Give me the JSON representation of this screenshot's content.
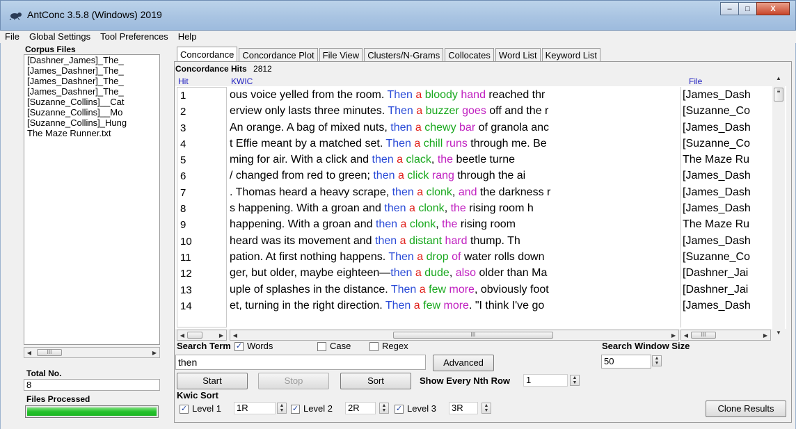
{
  "window": {
    "title": "AntConc 3.5.8 (Windows) 2019",
    "minimize": "–",
    "maximize": "□",
    "close": "X"
  },
  "menu": [
    "File",
    "Global Settings",
    "Tool Preferences",
    "Help"
  ],
  "left_panel": {
    "corpus_label": "Corpus Files",
    "files": [
      "[Dashner_James]_The_",
      "[James_Dashner]_The_",
      "[James_Dashner]_The_",
      "[James_Dashner]_The_",
      "[Suzanne_Collins]__Cat",
      "[Suzanne_Collins]__Mo",
      "[Suzanne_Collins]_Hung",
      "The Maze Runner.txt"
    ],
    "total_label": "Total No.",
    "total_value": "8",
    "processed_label": "Files Processed",
    "processed_fraction": 1.0
  },
  "tabs": [
    "Concordance",
    "Concordance Plot",
    "File View",
    "Clusters/N-Grams",
    "Collocates",
    "Word List",
    "Keyword List"
  ],
  "concordance": {
    "hits_label": "Concordance Hits",
    "hits_value": "2812",
    "col_hit": "Hit",
    "col_kwic": "KWIC",
    "col_file": "File",
    "rows": [
      {
        "hit": "1",
        "left": "ous voice yelled from the room. ",
        "node": "Then",
        "l1": "a",
        "l2": "bloody",
        "l3": "hand",
        "rest": " reached thr",
        "file": "[James_Dash"
      },
      {
        "hit": "2",
        "left": "erview only lasts three minutes. ",
        "node": "Then",
        "l1": "a",
        "l2": "buzzer",
        "l3": "goes",
        "rest": " off and the r",
        "file": "[Suzanne_Co"
      },
      {
        "hit": "3",
        "left": "An orange. A bag of mixed nuts, ",
        "node": "then",
        "l1": "a",
        "l2": "chewy",
        "l3": "bar",
        "rest": " of granola anc",
        "file": "[James_Dash"
      },
      {
        "hit": "4",
        "left": "t Effie meant by a matched set. ",
        "node": "Then",
        "l1": "a",
        "l2": "chill",
        "l3": "runs",
        "rest": " through me. Be",
        "file": "[Suzanne_Co"
      },
      {
        "hit": "5",
        "left": "ming for air. With a click and ",
        "node": "then",
        "l1": "a",
        "l2": "clack",
        "l3": "the",
        "rest": " beetle turne",
        "sep": ", ",
        "file": "The Maze Ru"
      },
      {
        "hit": "6",
        "left": "/ changed from red to green; ",
        "node": "then",
        "l1": "a",
        "l2": "click",
        "l3": "rang",
        "rest": " through the ai",
        "file": "[James_Dash"
      },
      {
        "hit": "7",
        "left": ". Thomas heard a heavy scrape, ",
        "node": "then",
        "l1": "a",
        "l2": "clonk",
        "l3": "and",
        "rest": " the darkness r",
        "sep": ", ",
        "file": "[James_Dash"
      },
      {
        "hit": "8",
        "left": "s happening. With a groan and ",
        "node": "then",
        "l1": "a",
        "l2": "clonk",
        "l3": "the",
        "rest": " rising room h",
        "sep": ", ",
        "file": "[James_Dash"
      },
      {
        "hit": "9",
        "left": "happening. With a groan and ",
        "node": "then",
        "l1": "a",
        "l2": "clonk",
        "l3": "the",
        "rest": " rising room",
        "sep": ", ",
        "file": "The Maze Ru"
      },
      {
        "hit": "10",
        "left": "heard was its movement and ",
        "node": "then",
        "l1": "a",
        "l2": "distant",
        "l3": "hard",
        "rest": " thump. Th",
        "file": "[James_Dash"
      },
      {
        "hit": "11",
        "left": "pation. At first nothing happens. ",
        "node": "Then",
        "l1": "a",
        "l2": "drop",
        "l3": "of",
        "rest": " water rolls down",
        "file": "[Suzanne_Co"
      },
      {
        "hit": "12",
        "left": "ger, but older, maybe eighteen—",
        "node": "then",
        "l1": "a",
        "l2": "dude",
        "l3": "also",
        "rest": " older than Ma",
        "sep": ", ",
        "file": "[Dashner_Jai"
      },
      {
        "hit": "13",
        "left": "uple of splashes in the distance. ",
        "node": "Then",
        "l1": "a",
        "l2": "few",
        "l3": "more",
        "rest": ", obviously foot",
        "file": "[Dashner_Jai"
      },
      {
        "hit": "14",
        "left": "et, turning in the right direction. ",
        "node": "Then",
        "l1": "a",
        "l2": "few",
        "l3": "more",
        "rest": ".  \"I think I've go",
        "file": "[James_Dash"
      }
    ]
  },
  "search": {
    "term_label": "Search Term",
    "words_label": "Words",
    "words_checked": true,
    "case_label": "Case",
    "case_checked": false,
    "regex_label": "Regex",
    "regex_checked": false,
    "value": "then",
    "advanced_label": "Advanced",
    "window_size_label": "Search Window Size",
    "window_size_value": "50"
  },
  "actions": {
    "start": "Start",
    "stop": "Stop",
    "sort": "Sort",
    "nth_label": "Show Every Nth Row",
    "nth_value": "1"
  },
  "kwic_sort": {
    "label": "Kwic Sort",
    "levels": [
      {
        "label": "Level 1",
        "value": "1R",
        "checked": true
      },
      {
        "label": "Level 2",
        "value": "2R",
        "checked": true
      },
      {
        "label": "Level 3",
        "value": "3R",
        "checked": true
      }
    ],
    "clone_label": "Clone Results"
  },
  "colors": {
    "node": "#2a4bd7",
    "level1": "#e0201a",
    "level2": "#19a81e",
    "level3": "#c020c0",
    "progress": "#25c12c"
  }
}
